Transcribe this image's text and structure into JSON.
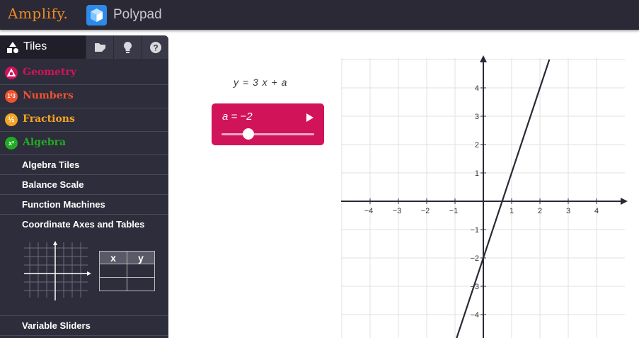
{
  "topbar": {
    "brand": "Amplify.",
    "app_name": "Polypad"
  },
  "sidebar": {
    "tabs": {
      "tiles_label": "Tiles",
      "icons": [
        "folder-icon",
        "lightbulb-icon",
        "help-icon"
      ]
    },
    "categories": [
      {
        "label": "Geometry",
        "color": "#d1145a",
        "icon": "geometry-icon"
      },
      {
        "label": "Numbers",
        "color": "#f0542f",
        "icon": "numbers-icon",
        "badge": "1²3"
      },
      {
        "label": "Fractions",
        "color": "#f5a523",
        "icon": "fractions-icon",
        "badge": "½"
      },
      {
        "label": "Algebra",
        "color": "#22ab24",
        "icon": "algebra-icon",
        "badge": "x²"
      }
    ],
    "algebra_items": [
      {
        "label": "Algebra Tiles"
      },
      {
        "label": "Balance Scale"
      },
      {
        "label": "Function Machines"
      },
      {
        "label": "Coordinate Axes and Tables"
      },
      {
        "label": "Variable Sliders"
      }
    ],
    "thumbnail_table": {
      "headers": [
        "x",
        "y"
      ]
    }
  },
  "canvas": {
    "formula": "y  =  3 x + a",
    "slider": {
      "label": "a  =  −2",
      "value": -2,
      "min": -10,
      "max": 10,
      "color": "#d1145a"
    }
  },
  "chart_data": {
    "type": "line",
    "series": [
      {
        "x": [
          -1,
          2.333
        ],
        "y": [
          -5,
          5
        ]
      }
    ],
    "equation": "y = 3x + a",
    "parameters": {
      "a": -2
    },
    "xlim": [
      -5,
      5
    ],
    "ylim": [
      -5,
      5
    ],
    "x_tick_labels": [
      "−4",
      "−3",
      "−2",
      "−1",
      "1",
      "2",
      "3",
      "4"
    ],
    "y_tick_labels": [
      "4",
      "3",
      "2",
      "1",
      "−1",
      "−2",
      "−3",
      "−4"
    ],
    "grid": true,
    "line_color": "#2a2935"
  }
}
